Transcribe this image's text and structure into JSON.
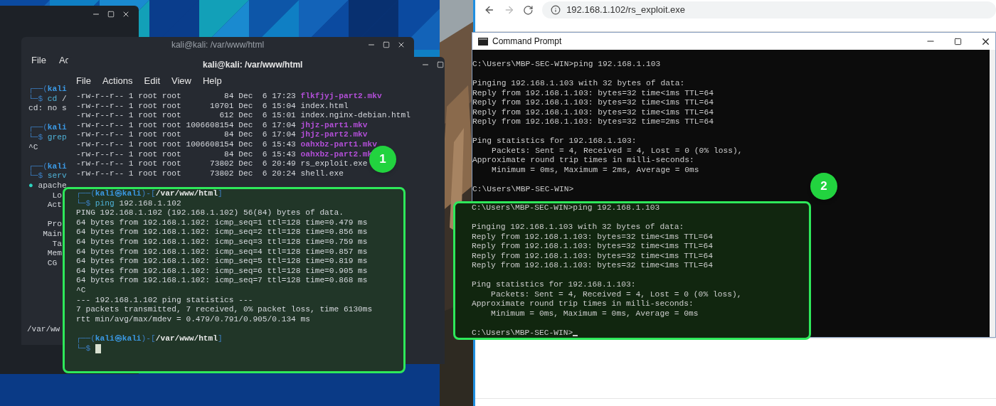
{
  "kali_middle_window": {
    "title": "kali@kali: /var/www/html",
    "menu": [
      "File",
      "Ac"
    ],
    "lines": [
      {
        "segments": [
          {
            "kind": "frame",
            "text": "┌──("
          },
          {
            "kind": "user",
            "text": "kali"
          }
        ]
      },
      {
        "segments": [
          {
            "kind": "frame",
            "text": "└─$ "
          },
          {
            "kind": "program",
            "text": "cd"
          },
          {
            "kind": "text",
            "text": " /"
          }
        ]
      },
      {
        "segments": [
          {
            "kind": "text",
            "text": "cd: no s"
          }
        ]
      },
      {
        "space_before": true,
        "segments": [
          {
            "kind": "frame",
            "text": "┌──("
          },
          {
            "kind": "user",
            "text": "kali"
          }
        ]
      },
      {
        "segments": [
          {
            "kind": "frame",
            "text": "└─$ "
          },
          {
            "kind": "program",
            "text": "grep"
          }
        ]
      },
      {
        "segments": [
          {
            "kind": "text",
            "text": "^C"
          }
        ]
      },
      {
        "space_before": true,
        "segments": [
          {
            "kind": "frame",
            "text": "┌──("
          },
          {
            "kind": "user",
            "text": "kali"
          }
        ]
      },
      {
        "segments": [
          {
            "kind": "frame",
            "text": "└─$ "
          },
          {
            "kind": "program",
            "text": "serv"
          }
        ]
      },
      {
        "segments": [
          {
            "kind": "dot",
            "text": "●"
          },
          {
            "kind": "text",
            "text": " apache"
          }
        ]
      },
      {
        "segments": [
          {
            "kind": "text",
            "text": "     Lo"
          }
        ]
      },
      {
        "segments": [
          {
            "kind": "text",
            "text": "    Act"
          }
        ]
      },
      {
        "space_before": true,
        "segments": [
          {
            "kind": "text",
            "text": "    Pro"
          }
        ]
      },
      {
        "segments": [
          {
            "kind": "text",
            "text": "   Main"
          }
        ]
      },
      {
        "segments": [
          {
            "kind": "text",
            "text": "     Ta"
          }
        ]
      },
      {
        "segments": [
          {
            "kind": "text",
            "text": "    Mem"
          }
        ]
      },
      {
        "segments": [
          {
            "kind": "text",
            "text": "    CG"
          }
        ]
      }
    ],
    "bottom_line": "/var/ww"
  },
  "kali_front_window": {
    "title": "kali@kali: /var/www/html",
    "menu": [
      "File",
      "Actions",
      "Edit",
      "View",
      "Help"
    ],
    "listing": [
      {
        "text": "-rw-r--r-- 1 root root         84 Dec  6 17:23 ",
        "name": "flkfjyj-part2.mkv",
        "kind": "video"
      },
      {
        "text": "-rw-r--r-- 1 root root      10701 Dec  6 15:04 ",
        "name": "index.html",
        "kind": "file"
      },
      {
        "text": "-rw-r--r-- 1 root root        612 Dec  6 15:01 ",
        "name": "index.nginx-debian.html",
        "kind": "file"
      },
      {
        "text": "-rw-r--r-- 1 root root 1006608154 Dec  6 17:04 ",
        "name": "jhjz-part1.mkv",
        "kind": "video"
      },
      {
        "text": "-rw-r--r-- 1 root root         84 Dec  6 17:04 ",
        "name": "jhjz-part2.mkv",
        "kind": "video"
      },
      {
        "text": "-rw-r--r-- 1 root root 1006608154 Dec  6 15:43 ",
        "name": "oahxbz-part1.mkv",
        "kind": "video"
      },
      {
        "text": "-rw-r--r-- 1 root root         84 Dec  6 15:43 ",
        "name": "oahxbz-part2.mk",
        "kind": "video"
      },
      {
        "text": "-rw-r--r-- 1 root root      73802 Dec  6 20:49 ",
        "name": "rs_exploit.exe",
        "kind": "file"
      },
      {
        "text": "-rw-r--r-- 1 root root      73802 Dec  6 20:24 ",
        "name": "shell.exe",
        "kind": "file"
      }
    ]
  },
  "highlight_1": {
    "badge": "1",
    "lines": [
      {
        "segments": [
          {
            "kind": "frame",
            "text": "┌──("
          },
          {
            "kind": "user",
            "text": "kali㉿kali"
          },
          {
            "kind": "frame",
            "text": ")-["
          },
          {
            "kind": "path",
            "text": "/var/www/html"
          },
          {
            "kind": "frame",
            "text": "]"
          }
        ]
      },
      {
        "segments": [
          {
            "kind": "frame",
            "text": "└─$ "
          },
          {
            "kind": "program",
            "text": "ping"
          },
          {
            "kind": "text",
            "text": " 192.168.1.102"
          }
        ]
      },
      {
        "segments": [
          {
            "kind": "text",
            "text": "PING 192.168.1.102 (192.168.1.102) 56(84) bytes of data."
          }
        ]
      },
      {
        "segments": [
          {
            "kind": "text",
            "text": "64 bytes from 192.168.1.102: icmp_seq=1 ttl=128 time=0.479 ms"
          }
        ]
      },
      {
        "segments": [
          {
            "kind": "text",
            "text": "64 bytes from 192.168.1.102: icmp_seq=2 ttl=128 time=0.856 ms"
          }
        ]
      },
      {
        "segments": [
          {
            "kind": "text",
            "text": "64 bytes from 192.168.1.102: icmp_seq=3 ttl=128 time=0.759 ms"
          }
        ]
      },
      {
        "segments": [
          {
            "kind": "text",
            "text": "64 bytes from 192.168.1.102: icmp_seq=4 ttl=128 time=0.857 ms"
          }
        ]
      },
      {
        "segments": [
          {
            "kind": "text",
            "text": "64 bytes from 192.168.1.102: icmp_seq=5 ttl=128 time=0.819 ms"
          }
        ]
      },
      {
        "segments": [
          {
            "kind": "text",
            "text": "64 bytes from 192.168.1.102: icmp_seq=6 ttl=128 time=0.905 ms"
          }
        ]
      },
      {
        "segments": [
          {
            "kind": "text",
            "text": "64 bytes from 192.168.1.102: icmp_seq=7 ttl=128 time=0.868 ms"
          }
        ]
      },
      {
        "segments": [
          {
            "kind": "text",
            "text": "^C"
          }
        ]
      },
      {
        "segments": [
          {
            "kind": "text",
            "text": "--- 192.168.1.102 ping statistics ---"
          }
        ]
      },
      {
        "segments": [
          {
            "kind": "text",
            "text": "7 packets transmitted, 7 received, 0% packet loss, time 6130ms"
          }
        ]
      },
      {
        "segments": [
          {
            "kind": "text",
            "text": "rtt min/avg/max/mdev = 0.479/0.791/0.905/0.134 ms"
          }
        ]
      },
      {
        "space_before": true,
        "segments": [
          {
            "kind": "frame",
            "text": "┌──("
          },
          {
            "kind": "user",
            "text": "kali㉿kali"
          },
          {
            "kind": "frame",
            "text": ")-["
          },
          {
            "kind": "path",
            "text": "/var/www/html"
          },
          {
            "kind": "frame",
            "text": "]"
          }
        ]
      },
      {
        "segments": [
          {
            "kind": "frame",
            "text": "└─$ "
          }
        ],
        "cursor": true
      }
    ]
  },
  "browser": {
    "url": "192.168.1.102/rs_exploit.exe"
  },
  "cmd_window": {
    "title": "Command Prompt",
    "lines": [
      {
        "text": "C:\\Users\\MBP-SEC-WIN>ping 192.168.1.103"
      },
      {
        "space_before": true,
        "text": "Pinging 192.168.1.103 with 32 bytes of data:"
      },
      {
        "text": "Reply from 192.168.1.103: bytes=32 time<1ms TTL=64"
      },
      {
        "text": "Reply from 192.168.1.103: bytes=32 time<1ms TTL=64"
      },
      {
        "text": "Reply from 192.168.1.103: bytes=32 time<1ms TTL=64"
      },
      {
        "text": "Reply from 192.168.1.103: bytes=32 time=2ms TTL=64"
      },
      {
        "space_before": true,
        "text": "Ping statistics for 192.168.1.103:"
      },
      {
        "text": "    Packets: Sent = 4, Received = 4, Lost = 0 (0% loss),"
      },
      {
        "text": "Approximate round trip times in milli-seconds:"
      },
      {
        "text": "    Minimum = 0ms, Maximum = 2ms, Average = 0ms"
      },
      {
        "space_before": true,
        "text": "C:\\Users\\MBP-SEC-WIN>"
      }
    ]
  },
  "highlight_2": {
    "badge": "2",
    "lines": [
      {
        "text": "C:\\Users\\MBP-SEC-WIN>ping 192.168.1.103"
      },
      {
        "space_before": true,
        "text": "Pinging 192.168.1.103 with 32 bytes of data:"
      },
      {
        "text": "Reply from 192.168.1.103: bytes=32 time<1ms TTL=64"
      },
      {
        "text": "Reply from 192.168.1.103: bytes=32 time<1ms TTL=64"
      },
      {
        "text": "Reply from 192.168.1.103: bytes=32 time<1ms TTL=64"
      },
      {
        "text": "Reply from 192.168.1.103: bytes=32 time<1ms TTL=64"
      },
      {
        "space_before": true,
        "text": "Ping statistics for 192.168.1.103:"
      },
      {
        "text": "    Packets: Sent = 4, Received = 4, Lost = 0 (0% loss),"
      },
      {
        "text": "Approximate round trip times in milli-seconds:"
      },
      {
        "text": "    Minimum = 0ms, Maximum = 0ms, Average = 0ms"
      },
      {
        "space_before": true,
        "text": "C:\\Users\\MBP-SEC-WIN>",
        "cursor": true
      }
    ]
  }
}
